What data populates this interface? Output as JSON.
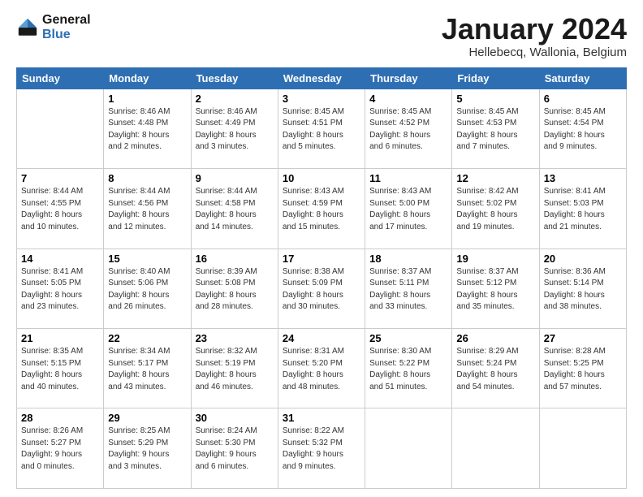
{
  "header": {
    "logo_line1": "General",
    "logo_line2": "Blue",
    "month": "January 2024",
    "location": "Hellebecq, Wallonia, Belgium"
  },
  "days_of_week": [
    "Sunday",
    "Monday",
    "Tuesday",
    "Wednesday",
    "Thursday",
    "Friday",
    "Saturday"
  ],
  "weeks": [
    [
      {
        "day": "",
        "info": ""
      },
      {
        "day": "1",
        "info": "Sunrise: 8:46 AM\nSunset: 4:48 PM\nDaylight: 8 hours\nand 2 minutes."
      },
      {
        "day": "2",
        "info": "Sunrise: 8:46 AM\nSunset: 4:49 PM\nDaylight: 8 hours\nand 3 minutes."
      },
      {
        "day": "3",
        "info": "Sunrise: 8:45 AM\nSunset: 4:51 PM\nDaylight: 8 hours\nand 5 minutes."
      },
      {
        "day": "4",
        "info": "Sunrise: 8:45 AM\nSunset: 4:52 PM\nDaylight: 8 hours\nand 6 minutes."
      },
      {
        "day": "5",
        "info": "Sunrise: 8:45 AM\nSunset: 4:53 PM\nDaylight: 8 hours\nand 7 minutes."
      },
      {
        "day": "6",
        "info": "Sunrise: 8:45 AM\nSunset: 4:54 PM\nDaylight: 8 hours\nand 9 minutes."
      }
    ],
    [
      {
        "day": "7",
        "info": "Sunrise: 8:44 AM\nSunset: 4:55 PM\nDaylight: 8 hours\nand 10 minutes."
      },
      {
        "day": "8",
        "info": "Sunrise: 8:44 AM\nSunset: 4:56 PM\nDaylight: 8 hours\nand 12 minutes."
      },
      {
        "day": "9",
        "info": "Sunrise: 8:44 AM\nSunset: 4:58 PM\nDaylight: 8 hours\nand 14 minutes."
      },
      {
        "day": "10",
        "info": "Sunrise: 8:43 AM\nSunset: 4:59 PM\nDaylight: 8 hours\nand 15 minutes."
      },
      {
        "day": "11",
        "info": "Sunrise: 8:43 AM\nSunset: 5:00 PM\nDaylight: 8 hours\nand 17 minutes."
      },
      {
        "day": "12",
        "info": "Sunrise: 8:42 AM\nSunset: 5:02 PM\nDaylight: 8 hours\nand 19 minutes."
      },
      {
        "day": "13",
        "info": "Sunrise: 8:41 AM\nSunset: 5:03 PM\nDaylight: 8 hours\nand 21 minutes."
      }
    ],
    [
      {
        "day": "14",
        "info": "Sunrise: 8:41 AM\nSunset: 5:05 PM\nDaylight: 8 hours\nand 23 minutes."
      },
      {
        "day": "15",
        "info": "Sunrise: 8:40 AM\nSunset: 5:06 PM\nDaylight: 8 hours\nand 26 minutes."
      },
      {
        "day": "16",
        "info": "Sunrise: 8:39 AM\nSunset: 5:08 PM\nDaylight: 8 hours\nand 28 minutes."
      },
      {
        "day": "17",
        "info": "Sunrise: 8:38 AM\nSunset: 5:09 PM\nDaylight: 8 hours\nand 30 minutes."
      },
      {
        "day": "18",
        "info": "Sunrise: 8:37 AM\nSunset: 5:11 PM\nDaylight: 8 hours\nand 33 minutes."
      },
      {
        "day": "19",
        "info": "Sunrise: 8:37 AM\nSunset: 5:12 PM\nDaylight: 8 hours\nand 35 minutes."
      },
      {
        "day": "20",
        "info": "Sunrise: 8:36 AM\nSunset: 5:14 PM\nDaylight: 8 hours\nand 38 minutes."
      }
    ],
    [
      {
        "day": "21",
        "info": "Sunrise: 8:35 AM\nSunset: 5:15 PM\nDaylight: 8 hours\nand 40 minutes."
      },
      {
        "day": "22",
        "info": "Sunrise: 8:34 AM\nSunset: 5:17 PM\nDaylight: 8 hours\nand 43 minutes."
      },
      {
        "day": "23",
        "info": "Sunrise: 8:32 AM\nSunset: 5:19 PM\nDaylight: 8 hours\nand 46 minutes."
      },
      {
        "day": "24",
        "info": "Sunrise: 8:31 AM\nSunset: 5:20 PM\nDaylight: 8 hours\nand 48 minutes."
      },
      {
        "day": "25",
        "info": "Sunrise: 8:30 AM\nSunset: 5:22 PM\nDaylight: 8 hours\nand 51 minutes."
      },
      {
        "day": "26",
        "info": "Sunrise: 8:29 AM\nSunset: 5:24 PM\nDaylight: 8 hours\nand 54 minutes."
      },
      {
        "day": "27",
        "info": "Sunrise: 8:28 AM\nSunset: 5:25 PM\nDaylight: 8 hours\nand 57 minutes."
      }
    ],
    [
      {
        "day": "28",
        "info": "Sunrise: 8:26 AM\nSunset: 5:27 PM\nDaylight: 9 hours\nand 0 minutes."
      },
      {
        "day": "29",
        "info": "Sunrise: 8:25 AM\nSunset: 5:29 PM\nDaylight: 9 hours\nand 3 minutes."
      },
      {
        "day": "30",
        "info": "Sunrise: 8:24 AM\nSunset: 5:30 PM\nDaylight: 9 hours\nand 6 minutes."
      },
      {
        "day": "31",
        "info": "Sunrise: 8:22 AM\nSunset: 5:32 PM\nDaylight: 9 hours\nand 9 minutes."
      },
      {
        "day": "",
        "info": ""
      },
      {
        "day": "",
        "info": ""
      },
      {
        "day": "",
        "info": ""
      }
    ]
  ]
}
